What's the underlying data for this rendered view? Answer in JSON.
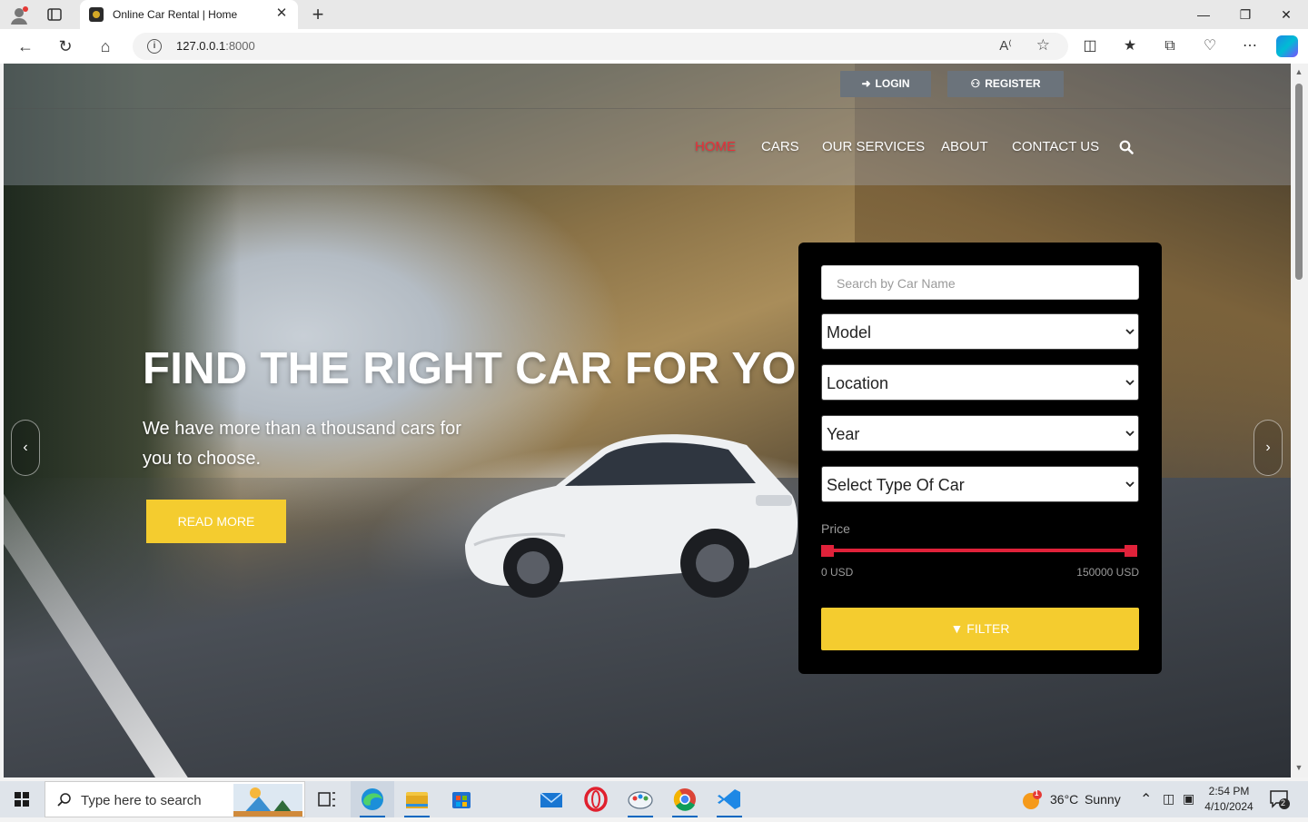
{
  "browser": {
    "tab_title": "Online Car Rental | Home",
    "url_host": "127.0.0.1",
    "url_port": ":8000",
    "newtab_glyph": "+",
    "tab_close_glyph": "✕",
    "icons": [
      "profile-icon",
      "tab-actions-icon",
      "back-icon",
      "refresh-icon",
      "home-icon",
      "site-info-icon",
      "read-aloud-icon",
      "favorite-star-icon",
      "split-screen-icon",
      "favorites-icon",
      "collections-icon",
      "browser-essentials-icon",
      "more-icon",
      "copilot-icon"
    ]
  },
  "header": {
    "login_label": "LOGIN",
    "register_label": "REGISTER",
    "nav": [
      "HOME",
      "CARS",
      "OUR SERVICES",
      "ABOUT",
      "CONTACT US"
    ],
    "active_nav": "HOME"
  },
  "hero": {
    "title": "FIND THE RIGHT CAR FOR YOU",
    "subtitle": "We have more than a thousand cars for you to choose.",
    "cta_label": "READ MORE"
  },
  "filter": {
    "search_placeholder": "Search by Car Name",
    "model_selected": "Model",
    "location_selected": "Location",
    "year_selected": "Year",
    "type_selected": "Select Type Of Car",
    "price_label": "Price",
    "price_min": "0 USD",
    "price_max": "150000 USD",
    "price_range": [
      0,
      150000
    ],
    "filter_label": "FILTER"
  },
  "taskbar": {
    "search_placeholder": "Type here to search",
    "weather_temp": "36°C",
    "weather_desc": "Sunny",
    "weather_badge": "1",
    "time": "2:54 PM",
    "date": "4/10/2024",
    "notification_count": "2",
    "apps": [
      "task-view",
      "edge",
      "file-explorer",
      "microsoft-store",
      "mail",
      "opera",
      "paint-app",
      "chrome",
      "vscode"
    ]
  },
  "colors": {
    "accent_yellow": "#f4cc2f",
    "active_red": "#e8303a",
    "slider_red": "#e0223a",
    "panel_black": "#000000",
    "top_button_gray": "#6b737b"
  }
}
